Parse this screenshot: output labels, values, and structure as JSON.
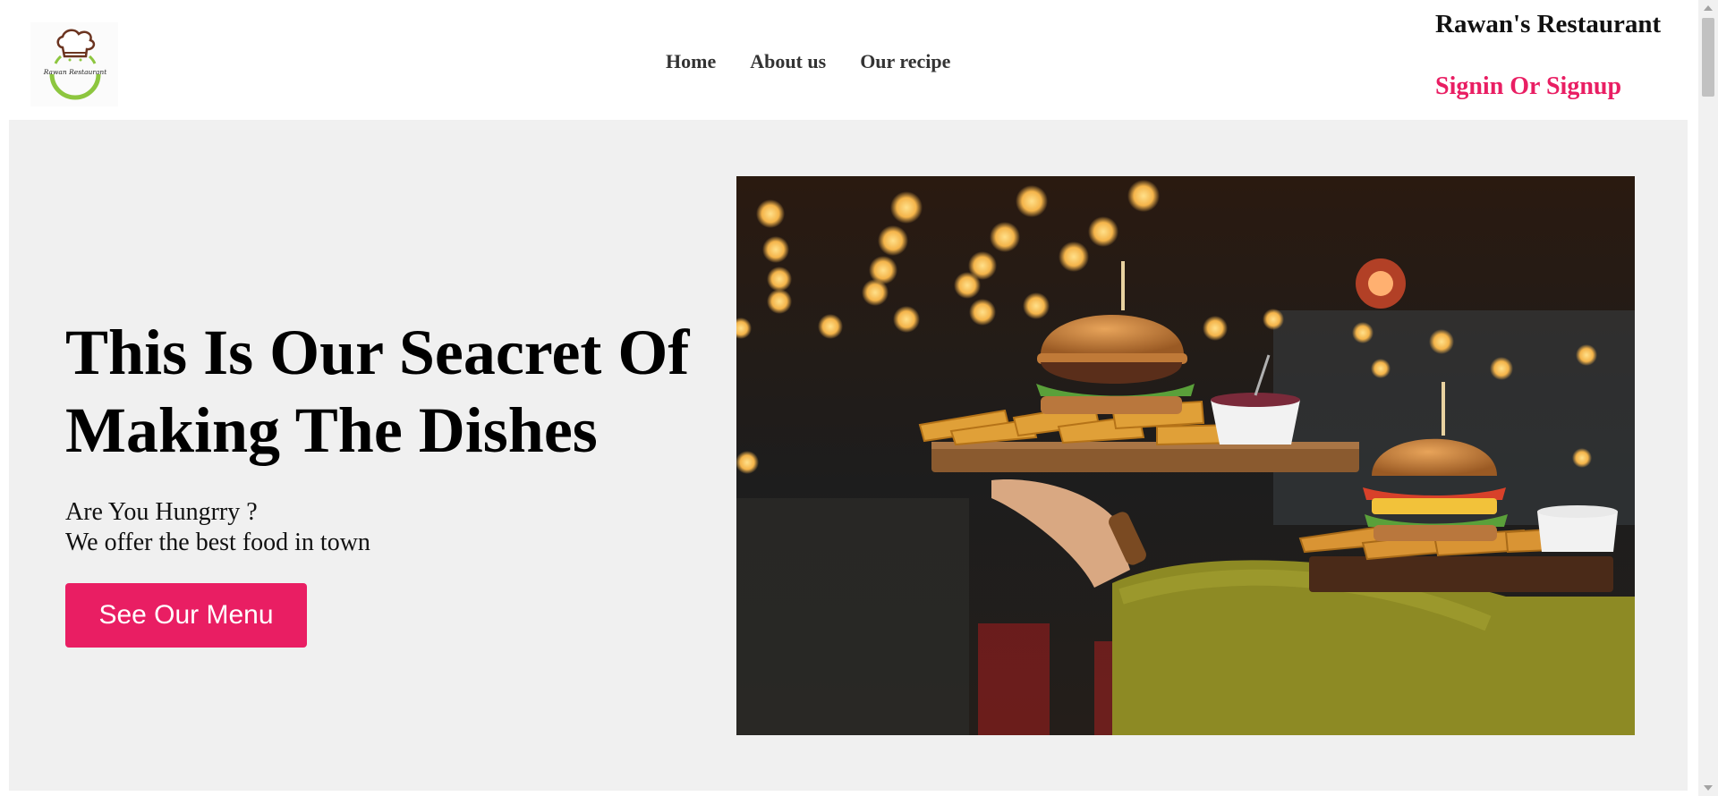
{
  "header": {
    "logo_text": "Rawan Restaurant",
    "nav": [
      {
        "label": "Home"
      },
      {
        "label": "About us"
      },
      {
        "label": "Our recipe"
      }
    ],
    "brand_name": "Rawan's Restaurant",
    "auth_link": "Signin Or Signup"
  },
  "hero": {
    "title": "This Is Our Seacret Of Making The Dishes",
    "tagline_line1": "Are You Hungrry ?",
    "tagline_line2": "We offer the best food in town",
    "cta_label": "See Our Menu"
  },
  "colors": {
    "accent": "#e91e63",
    "page_background": "#f0f0f0",
    "header_background": "#ffffff"
  }
}
